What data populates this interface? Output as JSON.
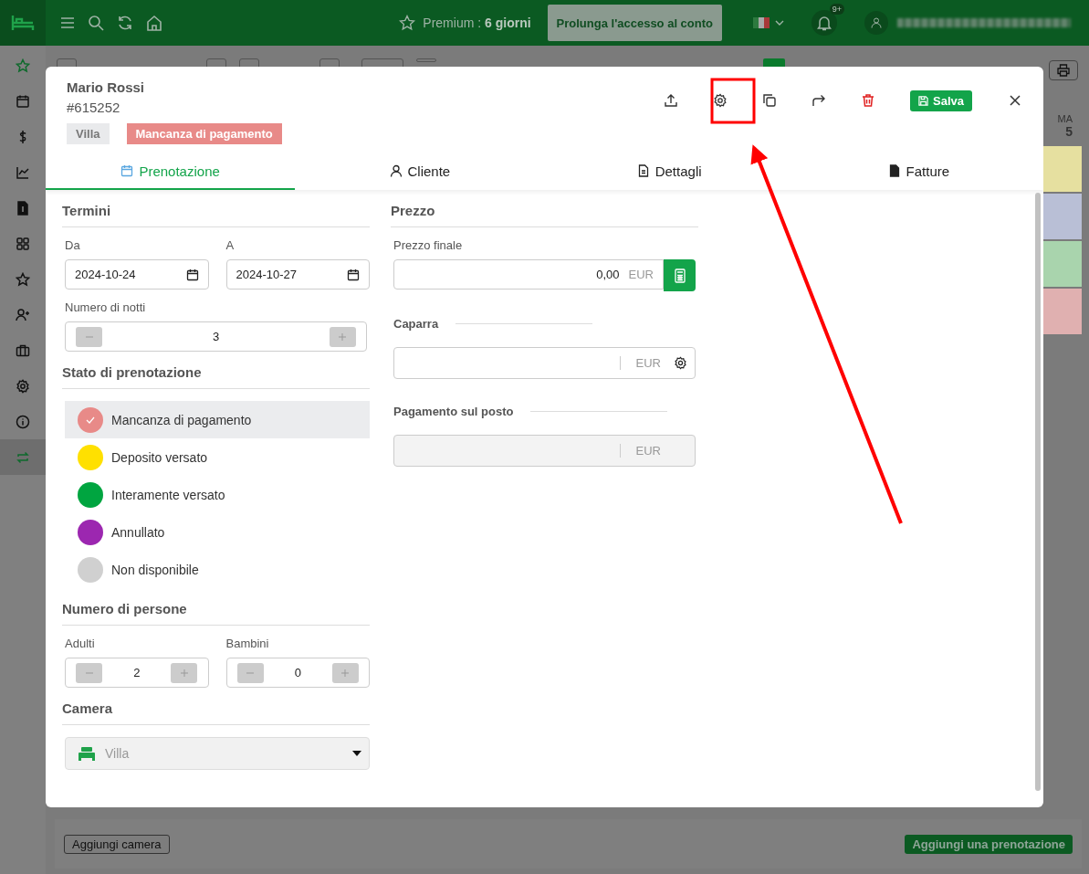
{
  "topbar": {
    "premium_label": "Premium :",
    "premium_days": "6 giorni",
    "extend_button": "Prolunga l'accesso al conto",
    "notifications_badge": "9+"
  },
  "sidebar": {
    "items": [
      {
        "selected": false
      },
      {
        "selected": false
      },
      {
        "selected": false
      },
      {
        "selected": false
      },
      {
        "selected": false
      },
      {
        "selected": false
      },
      {
        "selected": false
      },
      {
        "selected": false
      },
      {
        "selected": false
      },
      {
        "selected": false
      },
      {
        "selected": false
      },
      {
        "selected": true
      }
    ]
  },
  "day_header": {
    "weekday": "MA",
    "day": "5"
  },
  "booking_blocks": [
    {
      "color": "#e6e0a0"
    },
    {
      "color": "#b9bfd6"
    },
    {
      "color": "#a9d4ad"
    },
    {
      "color": "#e0b0b0"
    }
  ],
  "modal": {
    "guest_name": "Mario Rossi",
    "booking_id": "#615252",
    "save_button": "Salva",
    "tags": [
      {
        "label": "Villa",
        "color": "#e9eaec"
      },
      {
        "label": "Mancanza di pagamento",
        "color": "#e88a88"
      }
    ],
    "tabs": [
      {
        "label": "Prenotazione",
        "selected": true
      },
      {
        "label": "Cliente",
        "selected": false
      },
      {
        "label": "Dettagli",
        "selected": false
      },
      {
        "label": "Fatture",
        "selected": false
      }
    ],
    "terms": {
      "heading": "Termini",
      "from_label": "Da",
      "from_value": "2024-10-24",
      "to_label": "A",
      "to_value": "2024-10-27",
      "nights_label": "Numero di notti",
      "nights_value": "3"
    },
    "status": {
      "heading": "Stato di prenotazione",
      "options": [
        {
          "label": "Mancanza di pagamento",
          "color": "#e88a88",
          "selected": true
        },
        {
          "label": "Deposito versato",
          "color": "#ffe000",
          "selected": false
        },
        {
          "label": "Interamente versato",
          "color": "#00a540",
          "selected": false
        },
        {
          "label": "Annullato",
          "color": "#9c27b0",
          "selected": false
        },
        {
          "label": "Non disponibile",
          "color": "#d0d0d0",
          "selected": false
        }
      ]
    },
    "persons": {
      "heading": "Numero di persone",
      "adults_label": "Adulti",
      "adults_value": "2",
      "children_label": "Bambini",
      "children_value": "0"
    },
    "room": {
      "heading": "Camera",
      "value": "Villa"
    },
    "price": {
      "heading": "Prezzo",
      "final_label": "Prezzo finale",
      "final_value": "0,00",
      "currency": "EUR",
      "deposit_label": "Caparra",
      "deposit_currency": "EUR",
      "onsite_label": "Pagamento sul posto",
      "onsite_currency": "EUR"
    }
  },
  "bottom_bar": {
    "add_room_button": "Aggiungi camera",
    "add_booking_button": "Aggiungi una prenotazione"
  }
}
